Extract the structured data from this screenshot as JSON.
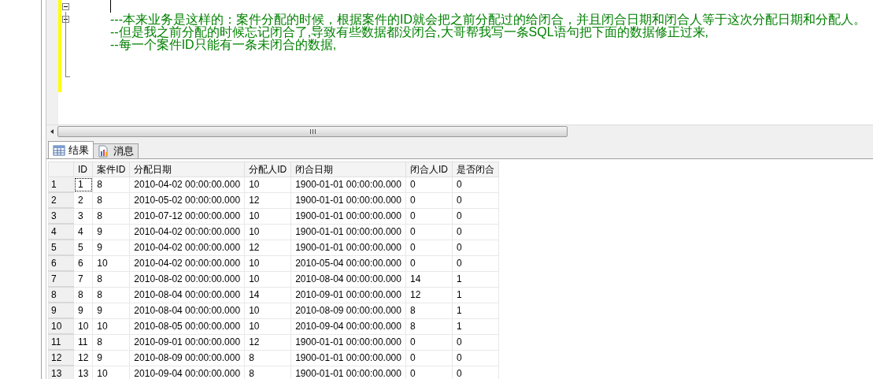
{
  "editor": {
    "lines": [
      {
        "kind": "cursor"
      },
      {
        "kind": "comment",
        "text": "---本来业务是这样的：案件分配的时候，根据案件的ID就会把之前分配过的给闭合，并且闭合日期和闭合人等于这次分配日期和分配人。"
      },
      {
        "kind": "comment",
        "text": "--但是我之前分配的时候忘记闭合了,导致有些数据都没闭合,大哥帮我写一条SQL语句把下面的数据修正过来,"
      },
      {
        "kind": "comment",
        "text": "--每一个案件ID只能有一条未闭合的数据,"
      }
    ]
  },
  "tabs": [
    {
      "label": "结果",
      "selected": true
    },
    {
      "label": "消息",
      "selected": false
    }
  ],
  "table": {
    "columns": [
      "ID",
      "案件ID",
      "分配日期",
      "分配人ID",
      "闭合日期",
      "闭合人ID",
      "是否闭合"
    ],
    "rows": [
      {
        "number": "1",
        "focused": true,
        "cells": [
          "1",
          "8",
          "2010-04-02 00:00:00.000",
          "10",
          "1900-01-01 00:00:00.000",
          "0",
          "0"
        ]
      },
      {
        "number": "2",
        "focused": false,
        "cells": [
          "2",
          "8",
          "2010-05-02 00:00:00.000",
          "12",
          "1900-01-01 00:00:00.000",
          "0",
          "0"
        ]
      },
      {
        "number": "3",
        "focused": false,
        "cells": [
          "3",
          "8",
          "2010-07-12 00:00:00.000",
          "10",
          "1900-01-01 00:00:00.000",
          "0",
          "0"
        ]
      },
      {
        "number": "4",
        "focused": false,
        "cells": [
          "4",
          "9",
          "2010-04-02 00:00:00.000",
          "10",
          "1900-01-01 00:00:00.000",
          "0",
          "0"
        ]
      },
      {
        "number": "5",
        "focused": false,
        "cells": [
          "5",
          "9",
          "2010-04-02 00:00:00.000",
          "12",
          "1900-01-01 00:00:00.000",
          "0",
          "0"
        ]
      },
      {
        "number": "6",
        "focused": false,
        "cells": [
          "6",
          "10",
          "2010-04-02 00:00:00.000",
          "10",
          "2010-05-04 00:00:00.000",
          "0",
          "0"
        ]
      },
      {
        "number": "7",
        "focused": false,
        "cells": [
          "7",
          "8",
          "2010-08-02 00:00:00.000",
          "10",
          "2010-08-04 00:00:00.000",
          "14",
          "1"
        ]
      },
      {
        "number": "8",
        "focused": false,
        "cells": [
          "8",
          "8",
          "2010-08-04 00:00:00.000",
          "14",
          "2010-09-01 00:00:00.000",
          "12",
          "1"
        ]
      },
      {
        "number": "9",
        "focused": false,
        "cells": [
          "9",
          "9",
          "2010-08-04 00:00:00.000",
          "10",
          "2010-08-09 00:00:00.000",
          "8",
          "1"
        ]
      },
      {
        "number": "10",
        "focused": false,
        "cells": [
          "10",
          "10",
          "2010-08-05 00:00:00.000",
          "10",
          "2010-09-04 00:00:00.000",
          "8",
          "1"
        ]
      },
      {
        "number": "11",
        "focused": false,
        "cells": [
          "11",
          "8",
          "2010-09-01 00:00:00.000",
          "12",
          "1900-01-01 00:00:00.000",
          "0",
          "0"
        ]
      },
      {
        "number": "12",
        "focused": false,
        "cells": [
          "12",
          "9",
          "2010-08-09 00:00:00.000",
          "8",
          "1900-01-01 00:00:00.000",
          "0",
          "0"
        ]
      },
      {
        "number": "13",
        "focused": false,
        "cells": [
          "13",
          "10",
          "2010-09-04 00:00:00.000",
          "8",
          "1900-01-01 00:00:00.000",
          "0",
          "0"
        ]
      }
    ]
  }
}
